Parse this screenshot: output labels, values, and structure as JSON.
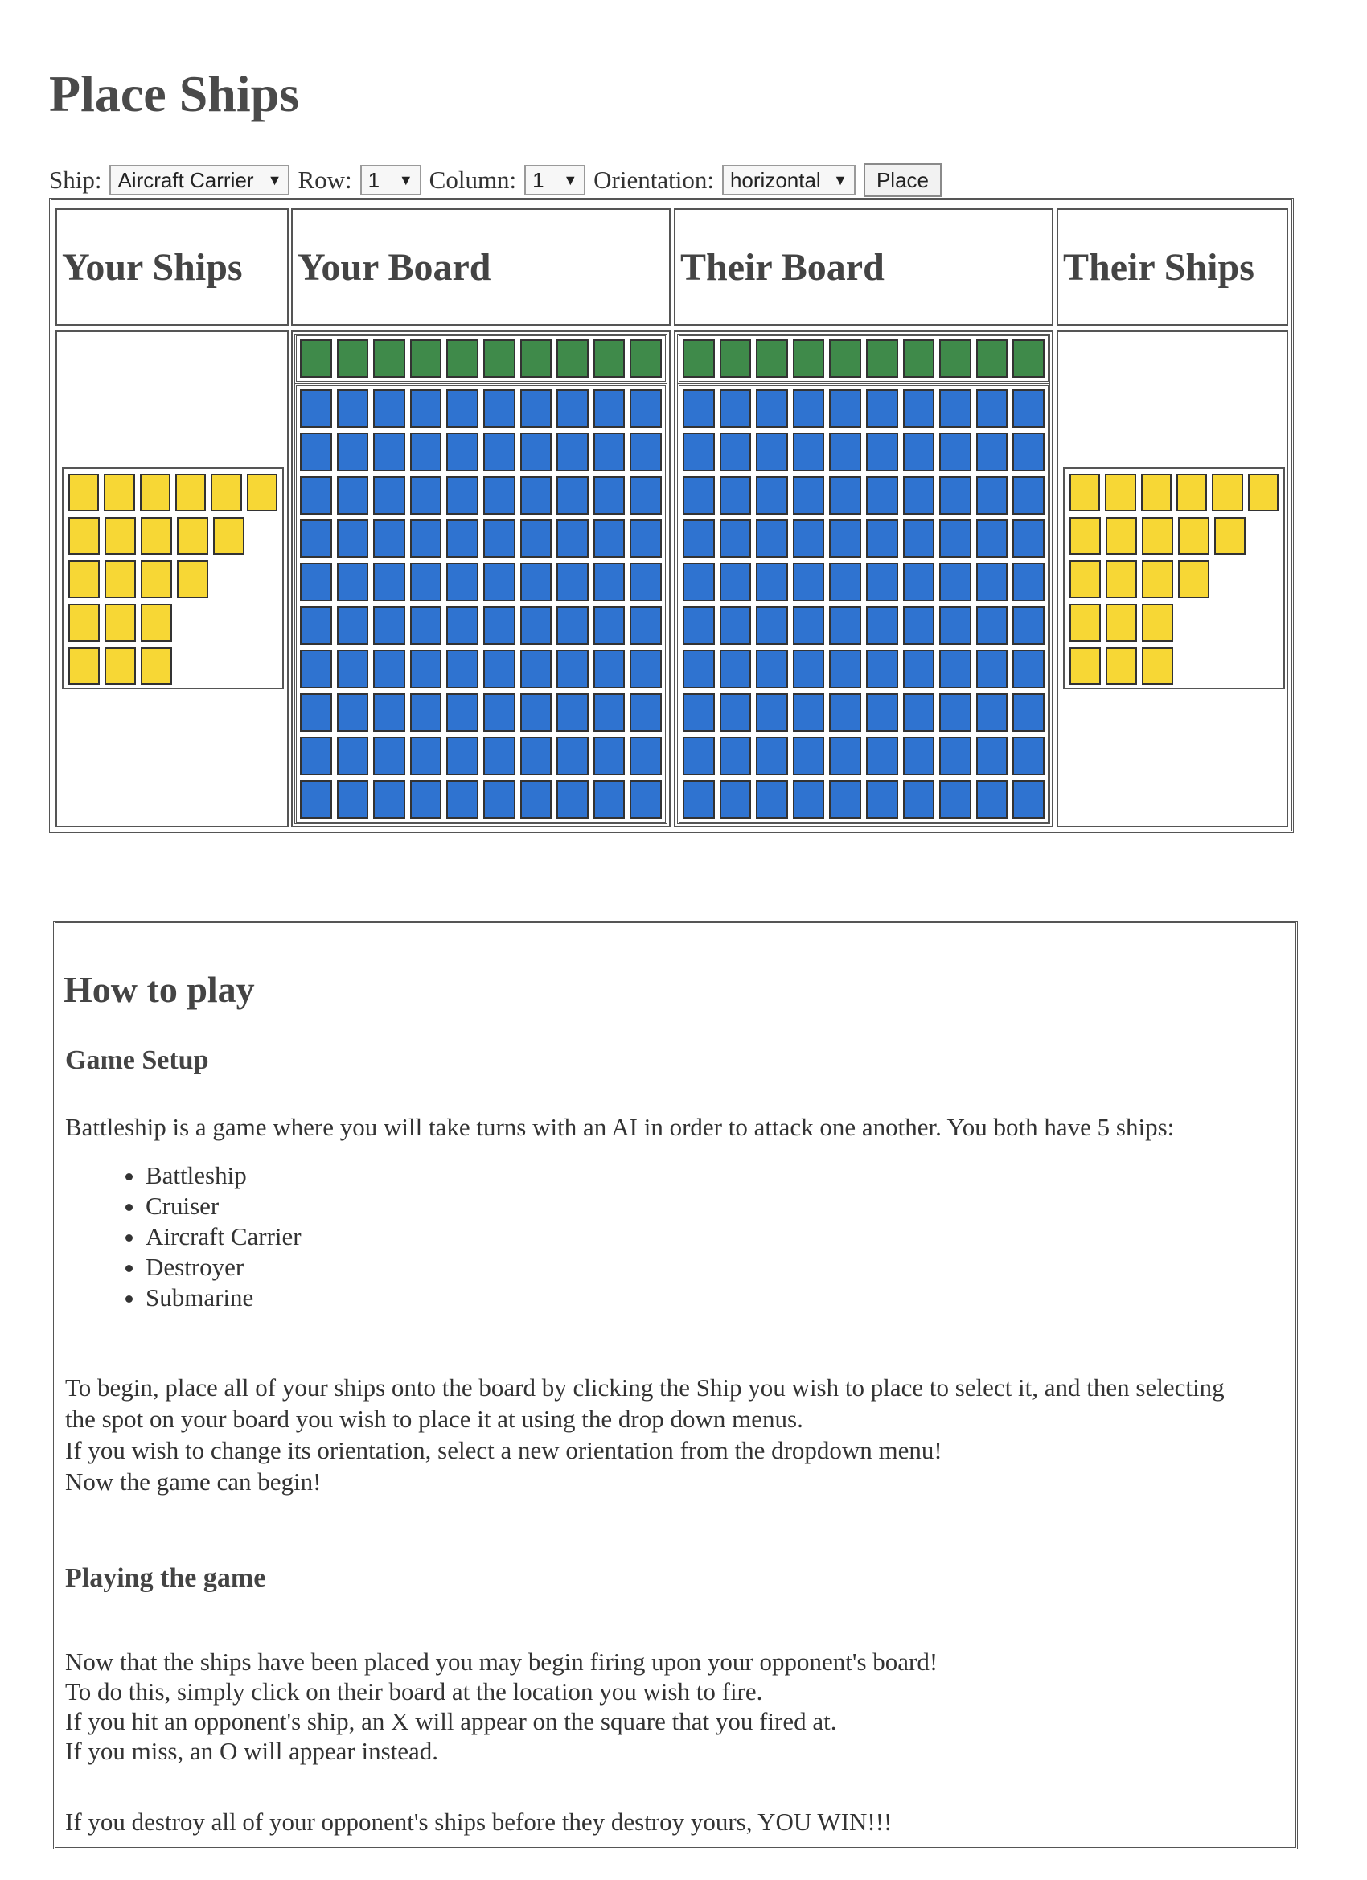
{
  "title": "Place Ships",
  "controls": {
    "ship_label": "Ship:",
    "ship_value": "Aircraft Carrier",
    "row_label": "Row:",
    "row_value": "1",
    "column_label": "Column:",
    "column_value": "1",
    "orientation_label": "Orientation:",
    "orientation_value": "horizontal",
    "place_button": "Place"
  },
  "board": {
    "your_ships": "Your Ships",
    "your_board": "Your Board",
    "their_board": "Their Board",
    "their_ships": "Their Ships",
    "size": 10,
    "colors": {
      "header_row": "#3f8a4a",
      "water": "#2f73d0",
      "ship": "#f7d735"
    },
    "ship_rows": [
      6,
      5,
      4,
      3,
      3
    ]
  },
  "howto": {
    "title": "How to play",
    "setup_title": "Game Setup",
    "intro": "Battleship is a game where you will take turns with an AI in order to attack one another. You both have 5 ships:",
    "ships": [
      "Battleship",
      "Cruiser",
      "Aircraft Carrier",
      "Destroyer",
      "Submarine"
    ],
    "setup_lines": [
      "To begin, place all of your ships onto the board by clicking the Ship you wish to place to select it, and then selecting",
      "the spot on your board you wish to place it at using the drop down menus.",
      "If you wish to change its orientation, select a new orientation from the dropdown menu!",
      "Now the game can begin!"
    ],
    "playing_title": "Playing the game",
    "playing_lines": [
      "Now that the ships have been placed you may begin firing upon your opponent's board!",
      "To do this, simply click on their board at the location you wish to fire.",
      "If you hit an opponent's ship, an X will appear on the square that you fired at.",
      "If you miss, an O will appear instead."
    ],
    "final_line": "If you destroy all of your opponent's ships before they destroy yours, YOU WIN!!!"
  }
}
